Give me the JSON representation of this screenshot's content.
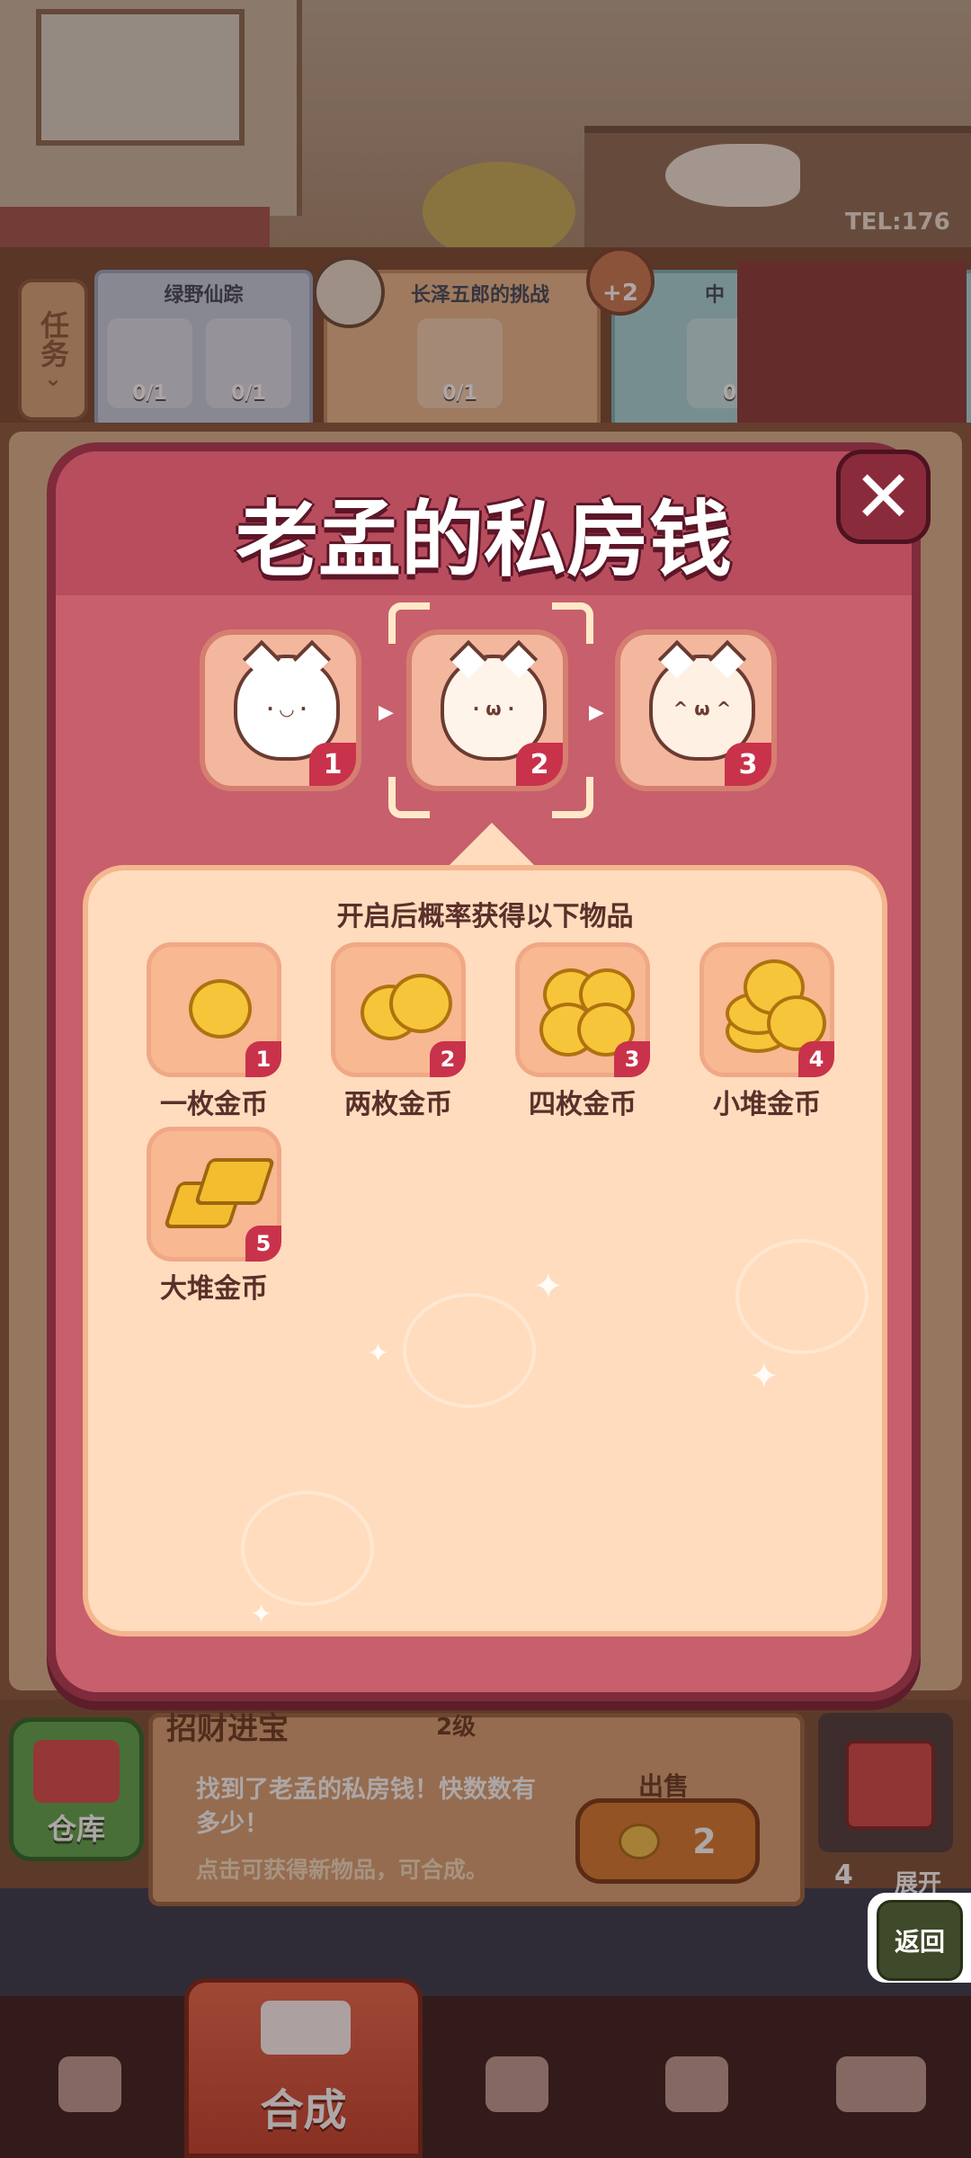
{
  "background": {
    "shop_tel": "TEL:176"
  },
  "quests": {
    "task_tab_label": "任务",
    "quest1": {
      "title": "绿野仙踪",
      "counts": [
        "0/1",
        "0/1"
      ]
    },
    "quest2": {
      "title": "长泽五郎的挑战",
      "counts": [
        "0/1"
      ]
    },
    "quest3": {
      "title": "中",
      "counts": [
        "0"
      ]
    },
    "bonus_badge": "+2"
  },
  "modal": {
    "title": "老孟的私房钱",
    "close_label": "✕",
    "stages": [
      {
        "level": "1",
        "face": "· ◡ ·"
      },
      {
        "level": "2",
        "face": "· ω ·"
      },
      {
        "level": "3",
        "face": "^ ω ^"
      }
    ],
    "selected_stage": 2,
    "drops_heading": "开启后概率获得以下物品",
    "items": [
      {
        "name": "一枚金币",
        "level": "1"
      },
      {
        "name": "两枚金币",
        "level": "2"
      },
      {
        "name": "四枚金币",
        "level": "3"
      },
      {
        "name": "小堆金币",
        "level": "4"
      },
      {
        "name": "大堆金币",
        "level": "5"
      }
    ]
  },
  "detail": {
    "title": "招财进宝",
    "level": "2级",
    "description": "找到了老孟的私房钱！快数数有多少！",
    "hint": "点击可获得新物品，可合成。",
    "sell_label": "出售",
    "sell_price": "2"
  },
  "warehouse_label": "仓库",
  "chest": {
    "count": "4",
    "open_label": "展开"
  },
  "back_label": "返回",
  "nav": {
    "active_label": "合成",
    "items": [
      "bag-icon",
      "merge-icon",
      "service-bell-icon",
      "staff-icon",
      "bus-icon"
    ]
  },
  "colors": {
    "modal_bg": "#c75f6c",
    "modal_border": "#7e2b3c",
    "content_bg": "#ffdcbd",
    "badge_red": "#c9324b",
    "coin_gold": "#f7c53a"
  }
}
